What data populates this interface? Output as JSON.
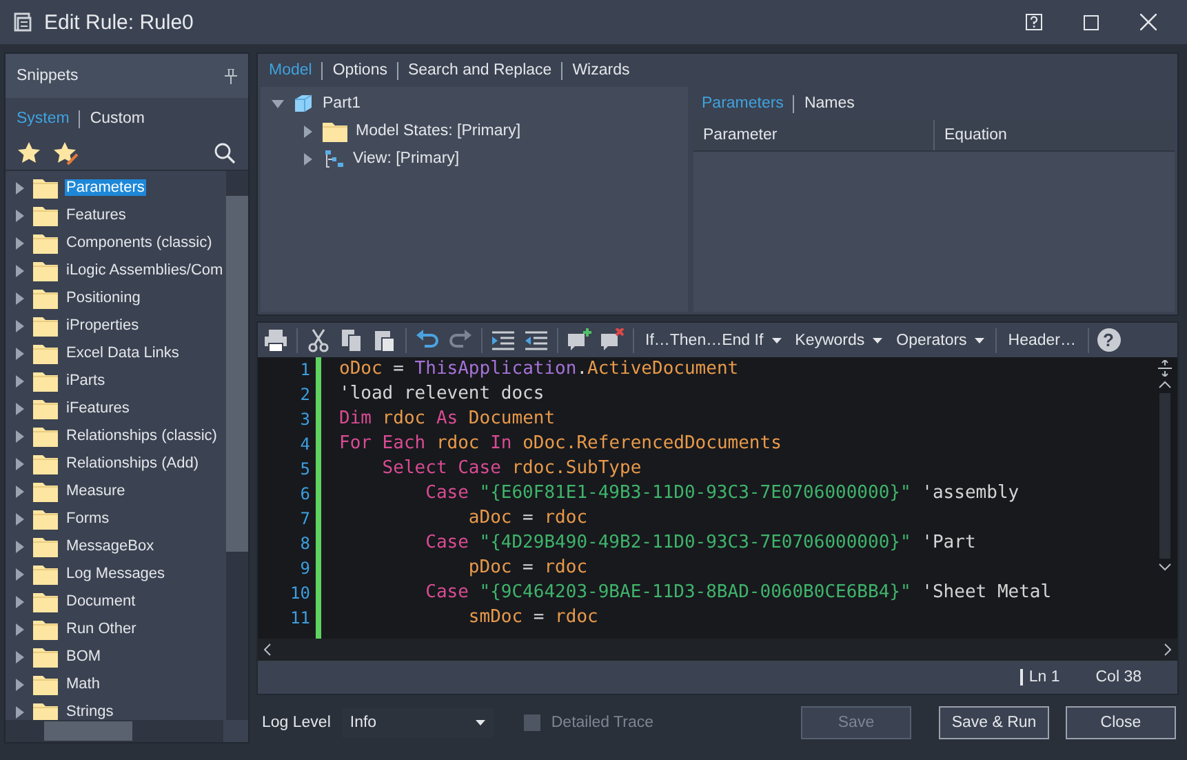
{
  "window": {
    "title": "Edit Rule: Rule0"
  },
  "snippets": {
    "title": "Snippets",
    "tabs": [
      {
        "label": "System",
        "selected": true
      },
      {
        "label": "Custom",
        "selected": false
      }
    ],
    "items": [
      {
        "label": "Parameters",
        "selected": true,
        "expanded": false
      },
      {
        "label": "Features",
        "selected": false,
        "expanded": false
      },
      {
        "label": "Components (classic)",
        "selected": false,
        "expanded": false
      },
      {
        "label": "iLogic Assemblies/Com",
        "selected": false,
        "expanded": false
      },
      {
        "label": "Positioning",
        "selected": false,
        "expanded": false
      },
      {
        "label": "iProperties",
        "selected": false,
        "expanded": false
      },
      {
        "label": "Excel Data Links",
        "selected": false,
        "expanded": false
      },
      {
        "label": "iParts",
        "selected": false,
        "expanded": false
      },
      {
        "label": "iFeatures",
        "selected": false,
        "expanded": false
      },
      {
        "label": "Relationships (classic)",
        "selected": false,
        "expanded": false
      },
      {
        "label": "Relationships (Add)",
        "selected": false,
        "expanded": false
      },
      {
        "label": "Measure",
        "selected": false,
        "expanded": false
      },
      {
        "label": "Forms",
        "selected": false,
        "expanded": false
      },
      {
        "label": "MessageBox",
        "selected": false,
        "expanded": false
      },
      {
        "label": "Log Messages",
        "selected": false,
        "expanded": false
      },
      {
        "label": "Document",
        "selected": false,
        "expanded": false
      },
      {
        "label": "Run Other",
        "selected": false,
        "expanded": false
      },
      {
        "label": "BOM",
        "selected": false,
        "expanded": false
      },
      {
        "label": "Math",
        "selected": false,
        "expanded": false
      },
      {
        "label": "Strings",
        "selected": false,
        "expanded": false
      }
    ]
  },
  "main_tabs": [
    {
      "label": "Model",
      "selected": true
    },
    {
      "label": "Options",
      "selected": false
    },
    {
      "label": "Search and Replace",
      "selected": false
    },
    {
      "label": "Wizards",
      "selected": false
    }
  ],
  "model_tree": [
    {
      "label": "Part1",
      "kind": "part",
      "expanded": true,
      "children": [
        {
          "label": "Model States: [Primary]",
          "kind": "folder",
          "expanded": false
        },
        {
          "label": "View: [Primary]",
          "kind": "view",
          "expanded": false
        }
      ]
    }
  ],
  "parameters": {
    "tabs": [
      {
        "label": "Parameters",
        "selected": true
      },
      {
        "label": "Names",
        "selected": false
      }
    ],
    "columns": [
      "Parameter",
      "Equation"
    ]
  },
  "toolbar": {
    "menus": [
      "If…Then…End If",
      "Keywords",
      "Operators"
    ],
    "header": "Header…",
    "help": "?"
  },
  "editor": {
    "lines": [
      {
        "number": "1",
        "tokens": [
          {
            "t": "oDoc",
            "kind": "var"
          },
          {
            "t": " = ",
            "kind": "plain"
          },
          {
            "t": "ThisApplication",
            "kind": "type"
          },
          {
            "t": ".",
            "kind": "plain"
          },
          {
            "t": "ActiveDocument",
            "kind": "var"
          }
        ]
      },
      {
        "number": "2",
        "tokens": [
          {
            "t": "'load relevent docs",
            "kind": "comment"
          }
        ]
      },
      {
        "number": "3",
        "tokens": [
          {
            "t": "Dim",
            "kind": "kw"
          },
          {
            "t": " rdoc ",
            "kind": "var"
          },
          {
            "t": "As",
            "kind": "kw"
          },
          {
            "t": " Document",
            "kind": "var"
          }
        ]
      },
      {
        "number": "4",
        "tokens": [
          {
            "t": "For Each",
            "kind": "kw"
          },
          {
            "t": " rdoc ",
            "kind": "var"
          },
          {
            "t": "In",
            "kind": "kw"
          },
          {
            "t": " oDoc.ReferencedDocuments",
            "kind": "var"
          }
        ]
      },
      {
        "number": "5",
        "tokens": [
          {
            "t": "    Select Case",
            "kind": "kw"
          },
          {
            "t": " rdoc.SubType",
            "kind": "var"
          }
        ]
      },
      {
        "number": "6",
        "tokens": [
          {
            "t": "        Case",
            "kind": "kw"
          },
          {
            "t": " \"{E60F81E1-49B3-11D0-93C3-7E0706000000}\"",
            "kind": "string"
          },
          {
            "t": " 'assembly",
            "kind": "comment"
          }
        ]
      },
      {
        "number": "7",
        "tokens": [
          {
            "t": "            aDoc",
            "kind": "var"
          },
          {
            "t": " = ",
            "kind": "plain"
          },
          {
            "t": "rdoc",
            "kind": "var"
          }
        ]
      },
      {
        "number": "8",
        "tokens": [
          {
            "t": "        Case",
            "kind": "kw"
          },
          {
            "t": " \"{4D29B490-49B2-11D0-93C3-7E0706000000}\"",
            "kind": "string"
          },
          {
            "t": " 'Part",
            "kind": "comment"
          }
        ]
      },
      {
        "number": "9",
        "tokens": [
          {
            "t": "            pDoc",
            "kind": "var"
          },
          {
            "t": " = ",
            "kind": "plain"
          },
          {
            "t": "rdoc",
            "kind": "var"
          }
        ]
      },
      {
        "number": "10",
        "tokens": [
          {
            "t": "        Case",
            "kind": "kw"
          },
          {
            "t": " \"{9C464203-9BAE-11D3-8BAD-0060B0CE6BB4}\"",
            "kind": "string"
          },
          {
            "t": " 'Sheet Metal",
            "kind": "comment"
          }
        ]
      },
      {
        "number": "11",
        "tokens": [
          {
            "t": "            smDoc",
            "kind": "var"
          },
          {
            "t": " = ",
            "kind": "plain"
          },
          {
            "t": "rdoc",
            "kind": "var"
          }
        ]
      }
    ]
  },
  "status": {
    "line": "Ln 1",
    "column": "Col 38"
  },
  "footer": {
    "log_level_label": "Log Level",
    "log_level": "Info",
    "detailed_trace": {
      "label": "Detailed Trace",
      "checked": false,
      "disabled": true
    },
    "buttons": [
      {
        "label": "Save",
        "disabled": true
      },
      {
        "label": "Save & Run",
        "disabled": false
      },
      {
        "label": "Close",
        "disabled": false
      }
    ]
  }
}
